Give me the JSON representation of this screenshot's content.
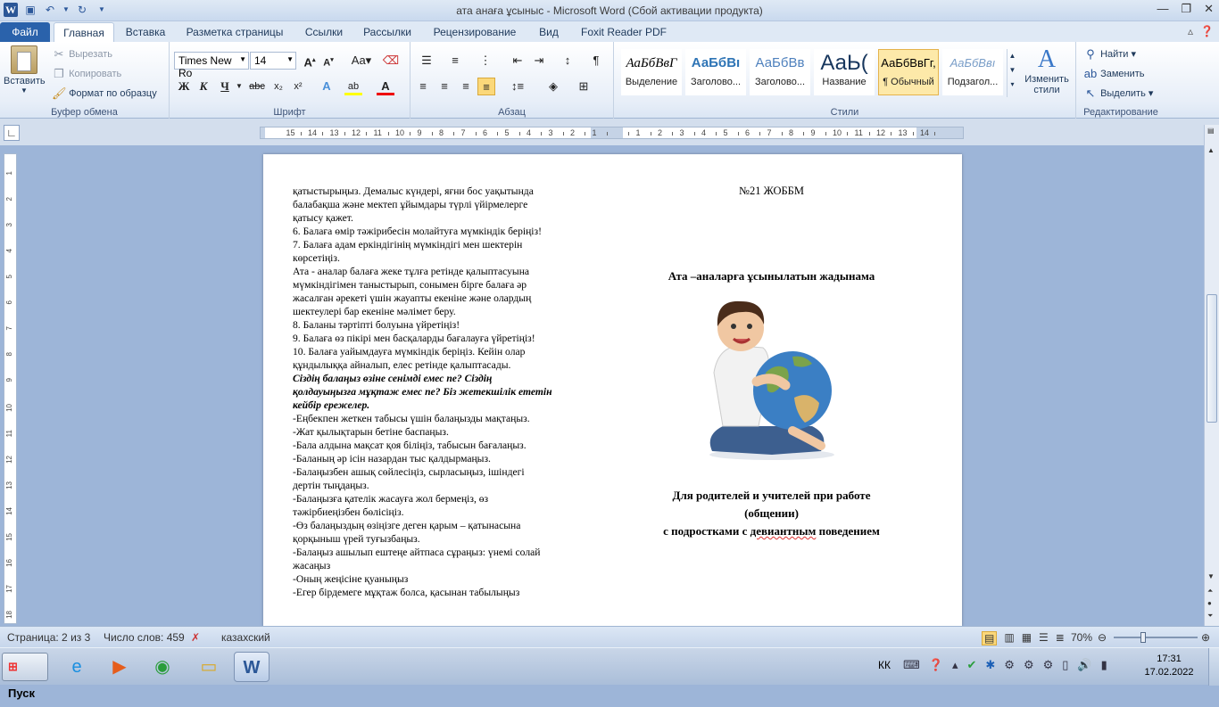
{
  "window": {
    "title": "ата анаға ұсыныс  -  Microsoft Word (Сбой активации продукта)"
  },
  "ribbon_tabs": [
    "Файл",
    "Главная",
    "Вставка",
    "Разметка страницы",
    "Ссылки",
    "Рассылки",
    "Рецензирование",
    "Вид",
    "Foxit Reader PDF"
  ],
  "clipboard": {
    "paste": "Вставить",
    "cut": "Вырезать",
    "copy": "Копировать",
    "format_painter": "Формат по образцу",
    "group": "Буфер обмена"
  },
  "font": {
    "name": "Times New Ro",
    "size": "14",
    "group": "Шрифт"
  },
  "paragraph": {
    "group": "Абзац"
  },
  "styles": {
    "group": "Стили",
    "items": [
      {
        "preview": "АаБбВвГ",
        "label": "Выделение"
      },
      {
        "preview": "АаБбВı",
        "label": "Заголово..."
      },
      {
        "preview": "АаБбВв",
        "label": "Заголово..."
      },
      {
        "preview": "АаЬ(",
        "label": "Название"
      },
      {
        "preview": "АаБбВвГг,",
        "label": "¶ Обычный"
      },
      {
        "preview": "АаБбВвı",
        "label": "Подзагол..."
      }
    ],
    "change": "Изменить стили"
  },
  "editing": {
    "find": "Найти",
    "replace": "Заменить",
    "select": "Выделить",
    "group": "Редактирование"
  },
  "document": {
    "left_lines": [
      "қатыстырыңыз. Демалыс күндері, яғни бос уақытында",
      "балабақша және мектеп ұйымдары түрлі үйірмелерге",
      "қатысу қажет.",
      "6. Балаға өмір тәжірибесін молайтуға мүмкіндік беріңіз!",
      "7. Балаға адам еркіндігінің  мүмкіндігі  мен шектерін",
      "көрсетіңіз.",
      "Ата -  аналар балаға жеке тұлға ретінде  қалыптасуына",
      "мүмкіндігімен  таныстырып, сонымен бірге балаға әр",
      "жасалған әрекеті үшін жауапты екеніне  және олардың",
      "шектеулері бар екеніне мәлімет беру.",
      "8. Баланы тәртіпті болуына үйретіңіз!",
      "9. Балаға өз пікірі мен басқаларды бағалауға үйретіңіз!",
      "10. Балаға уайымдауға мүмкіндік беріңіз. Кейін олар",
      "құндылыққа айналып, елес ретінде қалыптасады."
    ],
    "bold_lines": [
      "Сіздің балаңыз өзіне сенімді емес пе? Сіздің",
      "қолдауыңызға мұқтаж емес пе? Біз жетекшілік ететін",
      "кейбір ережелер."
    ],
    "rule_lines": [
      "-Еңбекпен жеткен табысы үшін балаңызды мақтаңыз.",
      "-Жат қылықтарын бетіне баспаңыз.",
      "-Бала алдына мақсат қоя біліңіз, табысын бағалаңыз.",
      "-Баланың әр ісін назардан тыс қалдырмаңыз.",
      "-Балаңызбен ашық сөйлесіңіз, сырласыңыз, ішіндегі",
      "дертін тыңдаңыз.",
      "-Балаңызға қателік жасауға жол бермеңіз, өз",
      "тәжірбиеңізбен бөлісіңіз.",
      "-Өз балаңыздың өзіңізге деген қарым – қатынасына",
      "қорқыныш үрей туғызбаңыз.",
      "-Балаңыз ашылып ештеңе айтпаса сұраңыз: үнемі солай",
      "жасаңыз",
      "-Оның жеңісіне қуаныңыз",
      "-Егер бірдемеге мұқтаж болса, қасынан табылыңыз"
    ],
    "school": "№21 ЖОББМ",
    "memo_title": "Ата –аналарға ұсынылатын жадынама",
    "for_line1": "Для родителей и учителей при работе",
    "for_line2": "(общении)",
    "for_line3a": "с подростками с ",
    "for_line3b": "девиантным",
    "for_line3c": " поведением"
  },
  "status": {
    "page": "Страница: 2 из 3",
    "words": "Число слов: 459",
    "language": "казахский",
    "zoom": "70%"
  },
  "taskbar": {
    "start": "Пуск",
    "lang": "КК",
    "time": "17:31",
    "date": "17.02.2022"
  }
}
